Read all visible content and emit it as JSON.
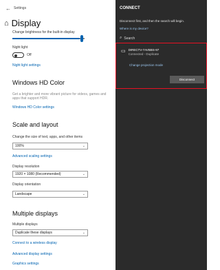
{
  "settings": {
    "window_title": "Settings",
    "page_title": "Display",
    "brightness_label": "Change brightness for the built-in display",
    "brightness_level": 0.93,
    "night_light": {
      "label": "Night light",
      "state": "Off",
      "settings_link": "Night light settings"
    },
    "hd_color": {
      "heading": "Windows HD Color",
      "description": "Get a brighter and more vibrant picture for videos, games and apps that support HDR.",
      "link": "Windows HD Color settings"
    },
    "scale_layout": {
      "heading": "Scale and layout",
      "scale_label": "Change the size of text, apps, and other items",
      "scale_value": "100%",
      "advanced_link": "Advanced scaling settings",
      "resolution_label": "Display resolution",
      "resolution_value": "1920 × 1080 (Recommended)",
      "orientation_label": "Display orientation",
      "orientation_value": "Landscape"
    },
    "multiple": {
      "heading": "Multiple displays",
      "label": "Multiple displays",
      "value": "Duplicate these displays",
      "connect_link": "Connect to a wireless display",
      "advanced_link": "Advanced display settings",
      "graphics_link": "Graphics settings"
    }
  },
  "project": {
    "header": "CONNECT",
    "hint": "Disconnect first, and then the search will begin.",
    "where_link": "Where is my device?",
    "search_label": "Search",
    "device": {
      "name": "DIRECTV-7AVBBS-97",
      "status": "Connected - Duplicate"
    },
    "change_mode": "Change projection mode",
    "disconnect_label": "Disconnect",
    "highlight_color": "#e81123",
    "panel_color": "#2b2b2b"
  }
}
